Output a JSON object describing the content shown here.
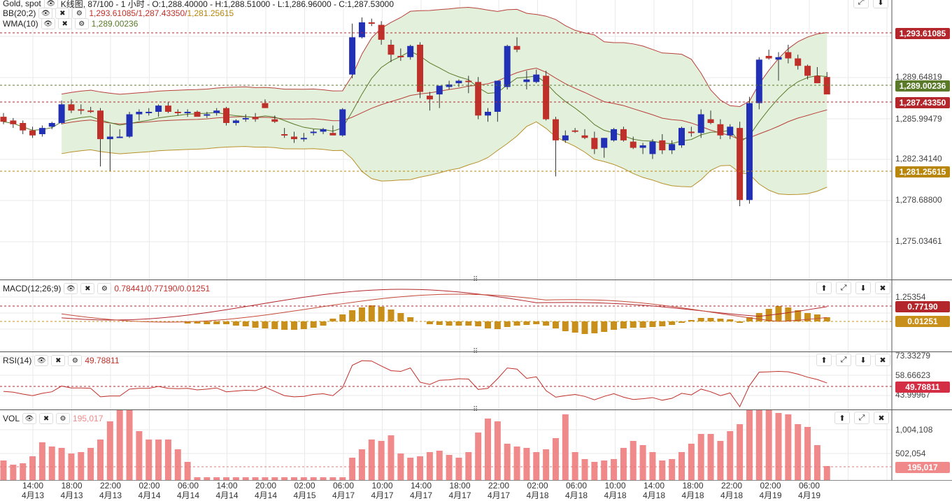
{
  "main": {
    "title_line": "Gold, spot",
    "title_rest": "K线图, 87/100 - 1 小时 - O:1,288.40000 - H:1,288.51000 - L:1,286.96000 - C:1,287.53000",
    "bb_label": "BB(20;2)",
    "bb_values": "1,293.61085/1,287.43350/",
    "bb_lower_value": "1,281.25615",
    "wma_label": "WMA(10)",
    "wma_value": "1,289.00236",
    "axis_labels": [
      "1,289.64819",
      "1,285.99479",
      "1,282.34140",
      "1,278.68800",
      "1,275.03461"
    ],
    "tags": {
      "upper": "1,293.61085",
      "wma": "1,289.00236",
      "mid": "1,287.43350",
      "lower": "1,281.25615"
    }
  },
  "macd": {
    "label": "MACD(12;26;9)",
    "values": "0.78441/0.77190/0.01251",
    "axis_top": "1.25354",
    "tag_signal": "0.77190",
    "tag_hist": "0.01251"
  },
  "rsi": {
    "label": "RSI(14)",
    "value": "49.78811",
    "axis_labels": [
      "73.33279",
      "58.66623",
      "43.99967"
    ],
    "tag": "49.78811"
  },
  "vol": {
    "label": "VOL",
    "value": "195,017",
    "axis_labels": [
      "1,004,108",
      "502,054"
    ],
    "tag": "195,017"
  },
  "x_axis": [
    {
      "time": "14:00",
      "date": "4月13"
    },
    {
      "time": "18:00",
      "date": "4月13"
    },
    {
      "time": "22:00",
      "date": "4月13"
    },
    {
      "time": "02:00",
      "date": "4月14"
    },
    {
      "time": "06:00",
      "date": "4月14"
    },
    {
      "time": "14:00",
      "date": "4月14"
    },
    {
      "time": "20:00",
      "date": "4月14"
    },
    {
      "time": "02:00",
      "date": "4月15"
    },
    {
      "time": "06:00",
      "date": "4月17"
    },
    {
      "time": "10:00",
      "date": "4月17"
    },
    {
      "time": "14:00",
      "date": "4月17"
    },
    {
      "time": "18:00",
      "date": "4月17"
    },
    {
      "time": "22:00",
      "date": "4月17"
    },
    {
      "time": "02:00",
      "date": "4月18"
    },
    {
      "time": "06:00",
      "date": "4月18"
    },
    {
      "time": "10:00",
      "date": "4月18"
    },
    {
      "time": "14:00",
      "date": "4月18"
    },
    {
      "time": "18:00",
      "date": "4月18"
    },
    {
      "time": "22:00",
      "date": "4月18"
    },
    {
      "time": "02:00",
      "date": "4月19"
    },
    {
      "time": "06:00",
      "date": "4月19"
    }
  ],
  "icons": [
    "eye-icon",
    "close-icon",
    "gear-icon",
    "arrow-up-icon",
    "expand-icon",
    "arrow-down-icon"
  ],
  "colors": {
    "up": "#2130b4",
    "down": "#c0302a",
    "bb_fill": "#e3f1dc",
    "bb_line": "#b8403a",
    "wma": "#5a7a2a",
    "hist": "#c8901a",
    "vol": "#f08a8a"
  },
  "chart_data": {
    "type": "candlestick",
    "x_index": [
      0,
      1,
      2,
      3,
      4,
      5,
      6,
      7,
      8,
      9,
      10,
      11,
      12,
      13,
      14,
      15,
      16,
      17,
      18,
      19,
      20,
      21,
      22,
      23,
      24,
      25,
      26,
      27,
      28,
      29,
      30,
      31,
      32,
      33,
      34,
      35,
      36,
      37,
      38,
      39,
      40,
      41,
      42,
      43,
      44,
      45,
      46,
      47,
      48,
      49,
      50,
      51,
      52,
      53,
      54,
      55,
      56,
      57,
      58,
      59,
      60,
      61,
      62,
      63,
      64,
      65,
      66,
      67,
      68,
      69,
      70,
      71,
      72,
      73,
      74,
      75,
      76,
      77,
      78,
      79,
      80,
      81,
      82,
      83,
      84,
      85
    ],
    "ohlc": [
      [
        1286.6,
        1286.9,
        1286.0,
        1286.2
      ],
      [
        1286.3,
        1286.5,
        1285.7,
        1286.0
      ],
      [
        1286.1,
        1286.3,
        1285.2,
        1285.5
      ],
      [
        1285.5,
        1285.8,
        1284.9,
        1285.1
      ],
      [
        1285.2,
        1285.9,
        1285.0,
        1285.7
      ],
      [
        1285.8,
        1286.2,
        1285.6,
        1286.1
      ],
      [
        1286.1,
        1287.9,
        1286.0,
        1287.6
      ],
      [
        1287.6,
        1288.0,
        1286.9,
        1287.1
      ],
      [
        1287.2,
        1287.6,
        1286.8,
        1287.1
      ],
      [
        1287.1,
        1287.4,
        1286.9,
        1287.0
      ],
      [
        1287.1,
        1287.3,
        1282.6,
        1284.8
      ],
      [
        1284.8,
        1286.0,
        1282.2,
        1285.0
      ],
      [
        1285.0,
        1285.6,
        1284.9,
        1285.0
      ],
      [
        1285.0,
        1287.0,
        1284.9,
        1286.8
      ],
      [
        1286.8,
        1287.2,
        1286.3,
        1287.0
      ],
      [
        1287.0,
        1287.3,
        1286.7,
        1287.0
      ],
      [
        1287.0,
        1287.6,
        1286.6,
        1287.5
      ],
      [
        1287.5,
        1287.8,
        1286.9,
        1287.0
      ],
      [
        1287.0,
        1287.2,
        1286.7,
        1286.9
      ],
      [
        1286.9,
        1287.2,
        1286.6,
        1287.0
      ],
      [
        1287.0,
        1287.1,
        1286.7,
        1286.6
      ],
      [
        1286.7,
        1287.0,
        1286.5,
        1286.8
      ],
      [
        1286.9,
        1287.3,
        1286.7,
        1287.1
      ],
      [
        1287.3,
        1287.4,
        1285.9,
        1286.1
      ],
      [
        1286.1,
        1286.4,
        1285.9,
        1286.3
      ],
      [
        1286.4,
        1286.8,
        1286.2,
        1286.5
      ],
      [
        1286.6,
        1286.9,
        1286.2,
        1286.4
      ],
      [
        1287.7,
        1288.0,
        1287.3,
        1287.3
      ],
      [
        1286.4,
        1286.7,
        1286.1,
        1286.2
      ],
      [
        1285.2,
        1285.7,
        1284.9,
        1285.1
      ],
      [
        1285.0,
        1285.4,
        1284.5,
        1284.8
      ],
      [
        1284.8,
        1285.3,
        1284.6,
        1284.9
      ],
      [
        1285.3,
        1285.6,
        1285.1,
        1285.4
      ],
      [
        1285.4,
        1285.7,
        1285.2,
        1285.6
      ],
      [
        1285.3,
        1285.9,
        1285.1,
        1285.1
      ],
      [
        1285.1,
        1287.3,
        1285.0,
        1287.2
      ],
      [
        1290.0,
        1294.1,
        1289.7,
        1293.0
      ],
      [
        1293.0,
        1294.6,
        1292.9,
        1294.2
      ],
      [
        1294.2,
        1294.5,
        1293.9,
        1294.1
      ],
      [
        1294.0,
        1294.3,
        1292.4,
        1292.8
      ],
      [
        1292.4,
        1292.8,
        1291.0,
        1291.6
      ],
      [
        1291.5,
        1292.1,
        1291.1,
        1291.4
      ],
      [
        1291.4,
        1292.4,
        1291.2,
        1292.3
      ],
      [
        1292.4,
        1292.6,
        1288.1,
        1288.6
      ],
      [
        1288.3,
        1288.6,
        1287.1,
        1288.0
      ],
      [
        1288.4,
        1289.0,
        1287.3,
        1289.1
      ],
      [
        1289.0,
        1289.5,
        1288.8,
        1289.2
      ],
      [
        1289.3,
        1289.6,
        1289.0,
        1289.5
      ],
      [
        1289.5,
        1289.9,
        1288.5,
        1289.4
      ],
      [
        1289.4,
        1289.8,
        1286.4,
        1286.7
      ],
      [
        1286.7,
        1287.3,
        1286.2,
        1287.0
      ],
      [
        1287.0,
        1289.5,
        1286.2,
        1289.5
      ],
      [
        1289.0,
        1292.4,
        1288.8,
        1292.3
      ],
      [
        1292.3,
        1293.0,
        1291.8,
        1292.0
      ],
      [
        1289.4,
        1290.3,
        1288.8,
        1289.6
      ],
      [
        1289.4,
        1290.4,
        1289.3,
        1290.0
      ],
      [
        1289.9,
        1290.3,
        1286.3,
        1286.4
      ],
      [
        1286.4,
        1286.6,
        1281.8,
        1284.7
      ],
      [
        1284.7,
        1285.5,
        1284.5,
        1285.1
      ],
      [
        1285.5,
        1285.7,
        1285.3,
        1285.4
      ],
      [
        1285.1,
        1285.6,
        1284.8,
        1284.9
      ],
      [
        1284.9,
        1285.4,
        1283.6,
        1284.0
      ],
      [
        1284.1,
        1284.9,
        1283.3,
        1284.9
      ],
      [
        1284.7,
        1285.7,
        1284.6,
        1285.6
      ],
      [
        1285.6,
        1285.8,
        1284.6,
        1284.7
      ],
      [
        1284.6,
        1285.0,
        1284.0,
        1284.1
      ],
      [
        1284.1,
        1284.5,
        1283.6,
        1284.3
      ],
      [
        1283.6,
        1284.8,
        1283.2,
        1284.6
      ],
      [
        1284.7,
        1285.2,
        1283.6,
        1283.9
      ],
      [
        1283.9,
        1284.7,
        1283.6,
        1284.4
      ],
      [
        1284.3,
        1285.8,
        1284.1,
        1285.7
      ],
      [
        1285.4,
        1285.8,
        1285.0,
        1285.3
      ],
      [
        1285.3,
        1287.2,
        1284.9,
        1286.8
      ],
      [
        1286.4,
        1287.1,
        1286.0,
        1286.1
      ],
      [
        1286.0,
        1286.4,
        1284.8,
        1285.1
      ],
      [
        1285.1,
        1286.0,
        1284.8,
        1285.8
      ],
      [
        1285.7,
        1286.2,
        1279.4,
        1279.9
      ],
      [
        1279.9,
        1288.2,
        1279.6,
        1287.7
      ],
      [
        1287.7,
        1291.4,
        1287.2,
        1291.2
      ],
      [
        1291.5,
        1292.0,
        1291.2,
        1291.3
      ],
      [
        1291.2,
        1291.8,
        1289.5,
        1291.4
      ],
      [
        1291.8,
        1292.4,
        1290.9,
        1291.3
      ],
      [
        1291.3,
        1291.6,
        1290.4,
        1290.7
      ],
      [
        1290.7,
        1290.8,
        1289.6,
        1289.9
      ],
      [
        1289.9,
        1290.6,
        1289.7,
        1289.3
      ],
      [
        1289.8,
        1290.2,
        1288.9,
        1288.4
      ]
    ],
    "ylim": [
      1273.5,
      1296.0
    ],
    "bb_upper": "1,293.61085",
    "bb_middle": "1,287.43350",
    "bb_lower": "1,281.25615",
    "wma": "1,289.00236"
  }
}
